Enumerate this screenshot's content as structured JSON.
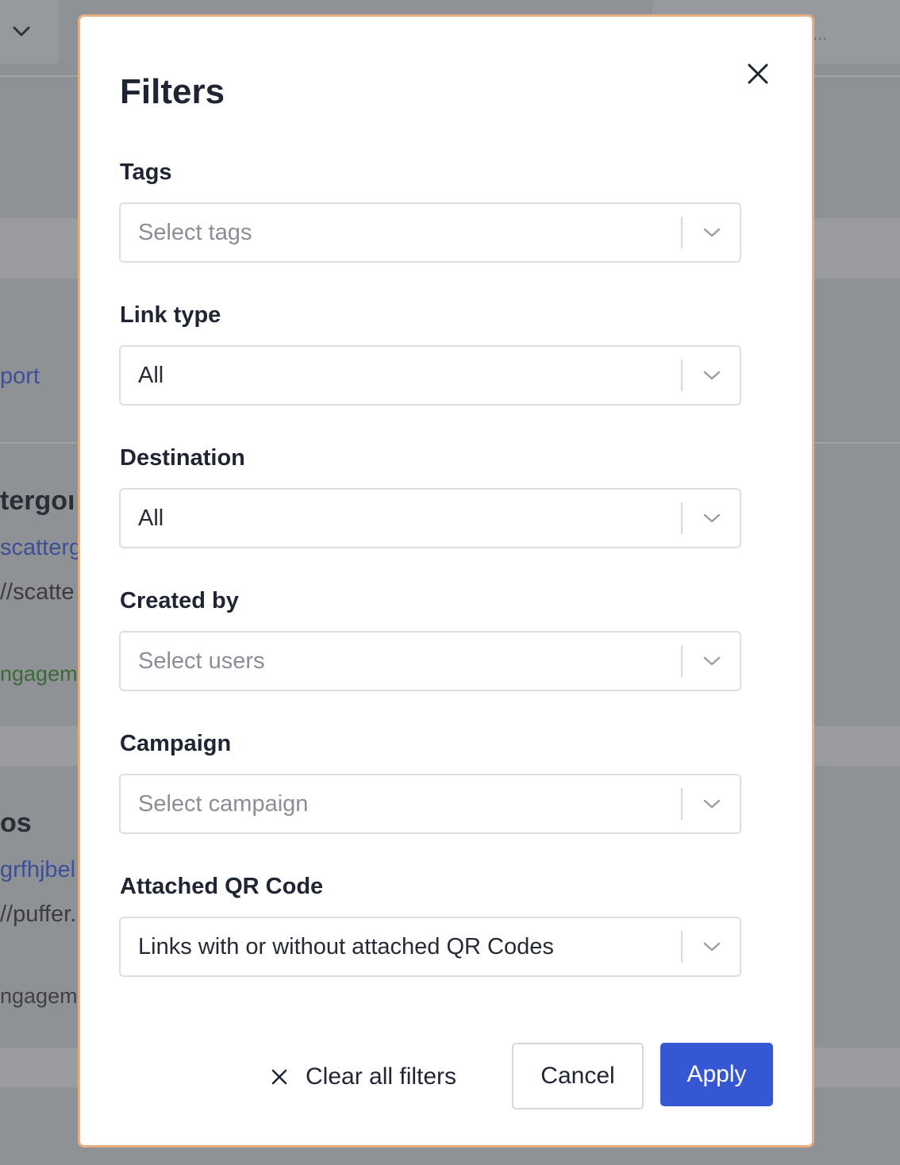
{
  "background": {
    "texts": {
      "port_link": "port",
      "title_1": "tergoı",
      "link_1": "scatterg",
      "url_1": "//scatte",
      "tag_1": "ngagem",
      "title_2": "os",
      "link_2": "grfhjbel",
      "url_2": "//puffer.",
      "tag_2": "ngagem",
      "ellipsis": "..."
    }
  },
  "modal": {
    "title": "Filters",
    "close_icon": "close-icon",
    "fields": [
      {
        "label": "Tags",
        "value": "Select tags",
        "is_placeholder": true
      },
      {
        "label": "Link type",
        "value": "All",
        "is_placeholder": false
      },
      {
        "label": "Destination",
        "value": "All",
        "is_placeholder": false
      },
      {
        "label": "Created by",
        "value": "Select users",
        "is_placeholder": true
      },
      {
        "label": "Campaign",
        "value": "Select campaign",
        "is_placeholder": true
      },
      {
        "label": "Attached QR Code",
        "value": "Links with or without attached QR Codes",
        "is_placeholder": false
      }
    ],
    "footer": {
      "clear_label": "Clear all filters",
      "cancel_label": "Cancel",
      "apply_label": "Apply"
    }
  },
  "colors": {
    "accent": "#3657d4",
    "modal_border": "#e7ae84",
    "overlay": "#8f9295",
    "text_primary": "#1f2533",
    "placeholder": "#8a8e96"
  }
}
